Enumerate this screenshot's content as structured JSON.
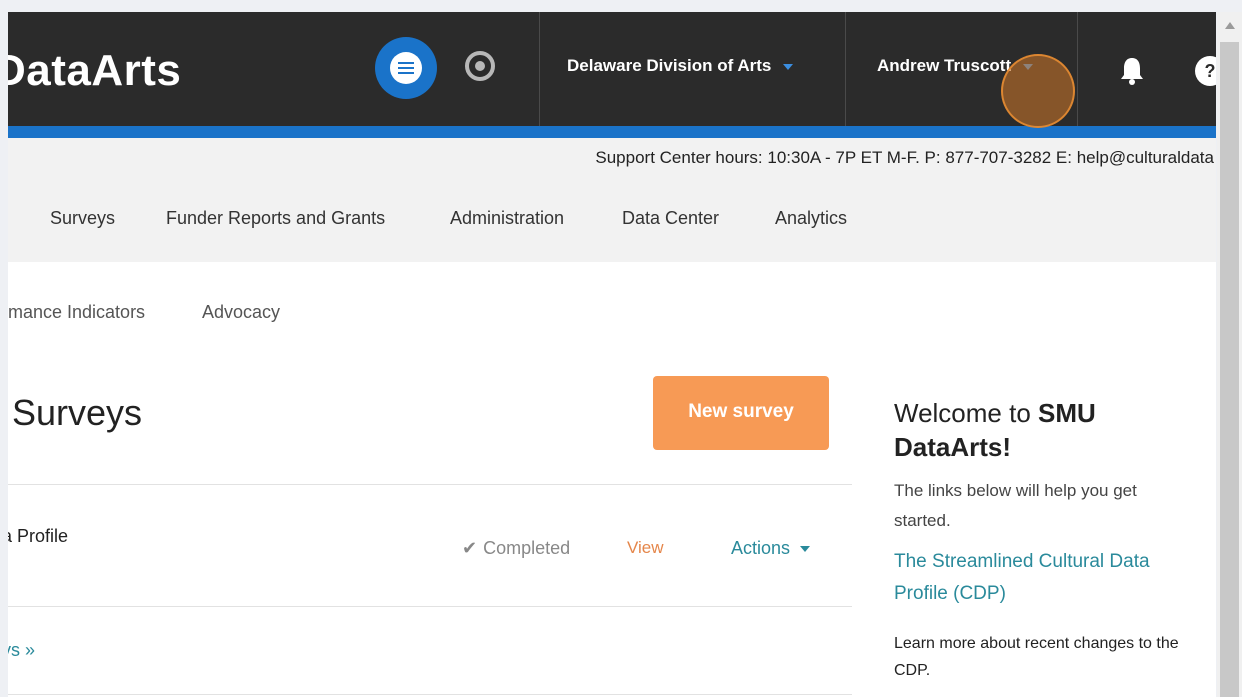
{
  "header": {
    "logo_text": "DataArts",
    "org_selector": "Delaware Division of Arts",
    "user_menu": "Andrew Truscott",
    "help_label": "?",
    "icons": [
      "list-icon",
      "target-icon",
      "chevron-down-icon",
      "bell-icon",
      "help-icon"
    ]
  },
  "support_bar": {
    "text": "Support Center hours: 10:30A - 7P ET M-F. P: 877-707-3282 E: help@culturaldata"
  },
  "main_nav": {
    "items": [
      "Surveys",
      "Funder Reports and Grants",
      "Administration",
      "Data Center",
      "Analytics"
    ]
  },
  "sub_nav": {
    "items": [
      "rmance Indicators",
      "Advocacy"
    ]
  },
  "page": {
    "title": "Surveys",
    "new_survey_label": "New survey"
  },
  "survey_row": {
    "title": "a Profile",
    "status": "Completed",
    "view_label": "View",
    "actions_label": "Actions"
  },
  "more_link": "ys »",
  "sidebar": {
    "welcome_prefix": "Welcome to ",
    "welcome_strong": "SMU DataArts!",
    "intro": "The links below will help you get started.",
    "cdp_link": "The Streamlined Cultural Data Profile (CDP)",
    "learn_more": "Learn more about recent changes to the CDP."
  },
  "colors": {
    "topbar": "#2b2b2b",
    "brand_blue": "#1a73c9",
    "cta_orange": "#f79a55",
    "link_teal": "#2a8a9b"
  }
}
